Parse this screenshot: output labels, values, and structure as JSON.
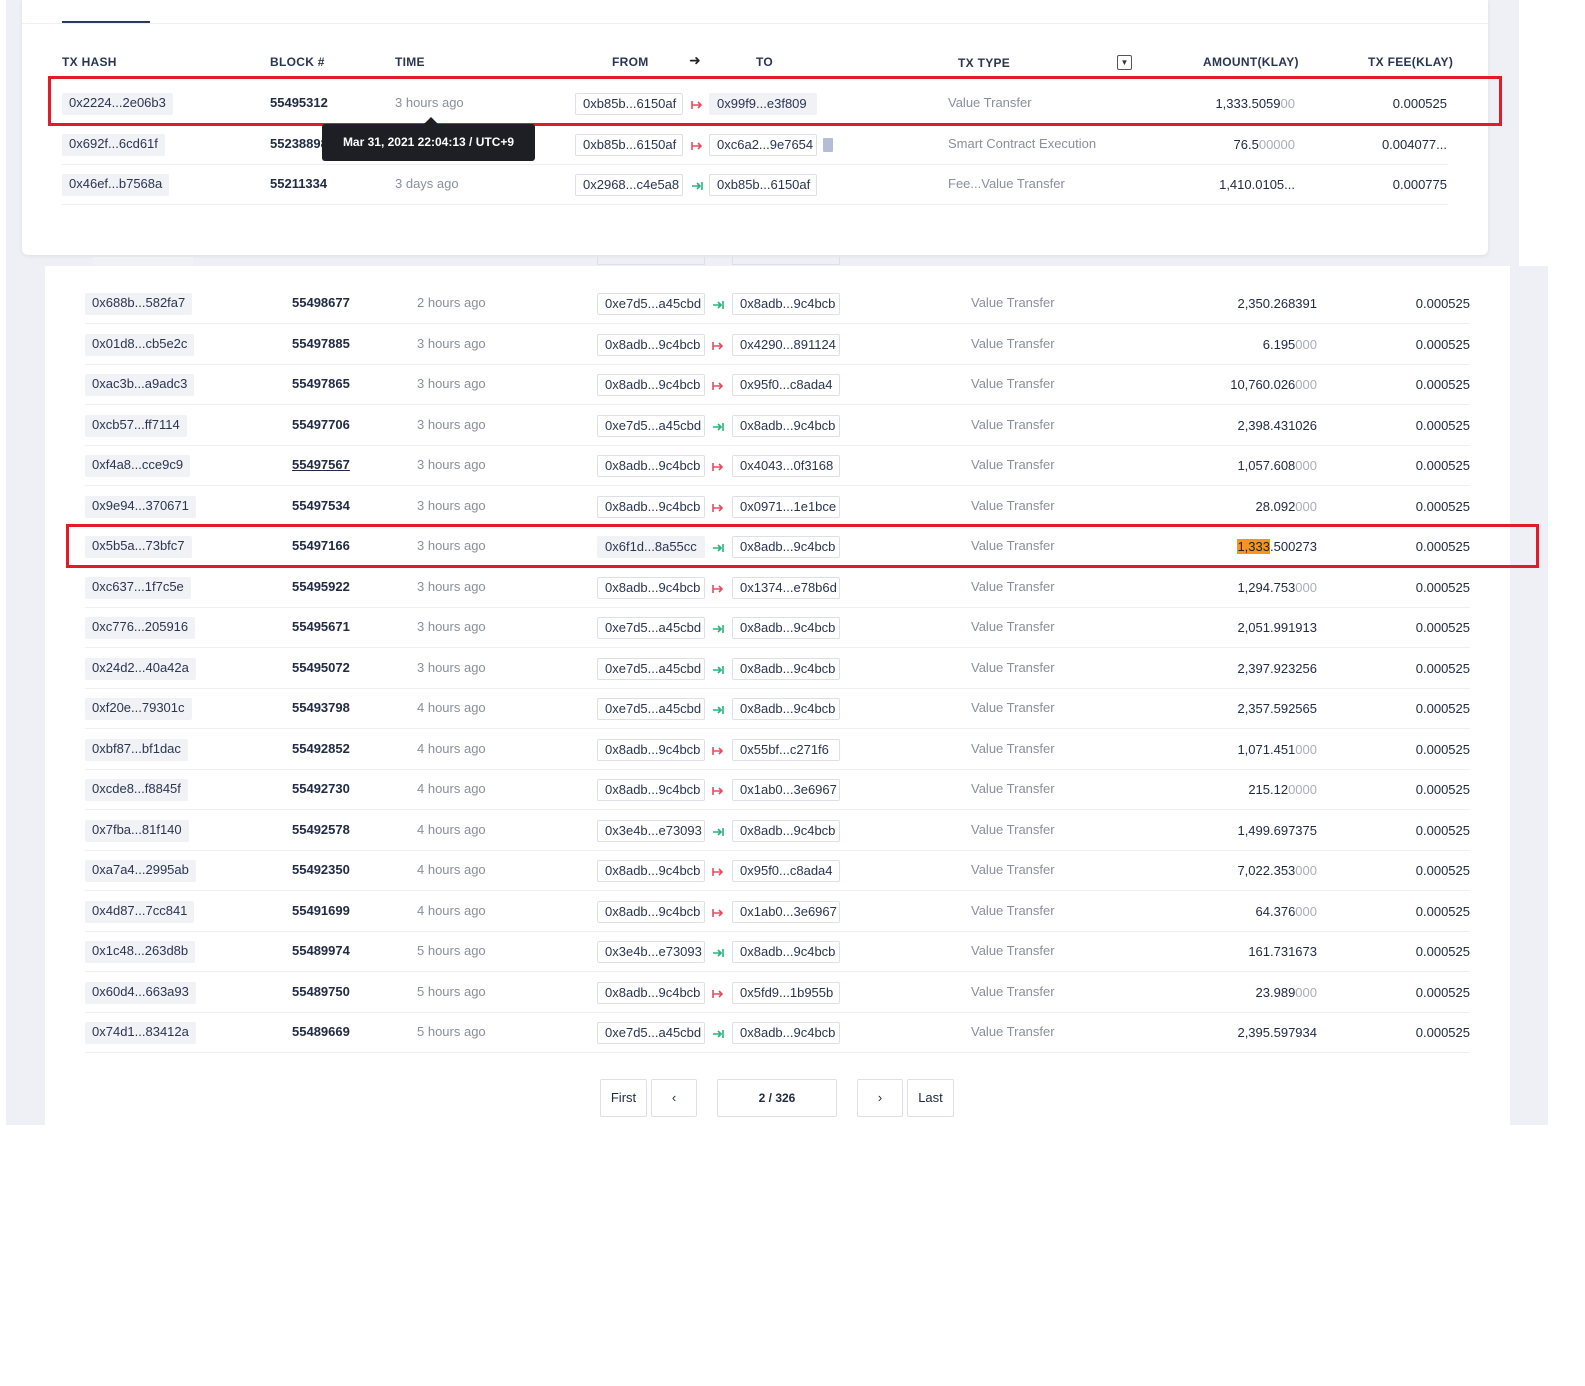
{
  "top": {
    "headers": {
      "tx_hash": "TX HASH",
      "block": "BLOCK #",
      "time": "TIME",
      "from": "FROM",
      "to": "TO",
      "tx_type": "TX TYPE",
      "amount": "AMOUNT(KLAY)",
      "fee": "TX FEE(KLAY)"
    },
    "tooltip": "Mar 31, 2021 22:04:13 / UTC+9",
    "rows": [
      {
        "hash": "0x2224...2e06b3",
        "block": "55495312",
        "time": "3 hours ago",
        "from": "0xb85b...6150af",
        "to": "0x99f9...e3f809",
        "dir": "out",
        "type": "Value Transfer",
        "amt_main": "1,333.5059",
        "amt_dim": "00",
        "fee": "0.000525"
      },
      {
        "hash": "0x692f...6cd61f",
        "block": "55238898",
        "time": "",
        "from": "0xb85b...6150af",
        "to": "0xc6a2...9e7654",
        "dir": "out",
        "type": "Smart Contract Execution",
        "amt_main": "76.5",
        "amt_dim": "00000",
        "fee": "0.004077..."
      },
      {
        "hash": "0x46ef...b7568a",
        "block": "55211334",
        "time": "3 days ago",
        "from": "0x2968...c4e5a8",
        "to": "0xb85b...6150af",
        "dir": "in",
        "type": "Fee...Value Transfer",
        "amt_main": "1,410.0105...",
        "amt_dim": "",
        "fee": "0.000775"
      }
    ]
  },
  "bottom": {
    "rows": [
      {
        "hash": "0x688b...582fa7",
        "block": "55498677",
        "time": "2 hours ago",
        "from": "0xe7d5...a45cbd",
        "to": "0x8adb...9c4bcb",
        "dir": "in",
        "type": "Value Transfer",
        "amt_main": "2,350.268391",
        "amt_dim": "",
        "fee": "0.000525"
      },
      {
        "hash": "0x01d8...cb5e2c",
        "block": "55497885",
        "time": "3 hours ago",
        "from": "0x8adb...9c4bcb",
        "to": "0x4290...891124",
        "dir": "out",
        "type": "Value Transfer",
        "amt_main": "6.195",
        "amt_dim": "000",
        "fee": "0.000525"
      },
      {
        "hash": "0xac3b...a9adc3",
        "block": "55497865",
        "time": "3 hours ago",
        "from": "0x8adb...9c4bcb",
        "to": "0x95f0...c8ada4",
        "dir": "out",
        "type": "Value Transfer",
        "amt_main": "10,760.026",
        "amt_dim": "000",
        "fee": "0.000525"
      },
      {
        "hash": "0xcb57...ff7114",
        "block": "55497706",
        "time": "3 hours ago",
        "from": "0xe7d5...a45cbd",
        "to": "0x8adb...9c4bcb",
        "dir": "in",
        "type": "Value Transfer",
        "amt_main": "2,398.431026",
        "amt_dim": "",
        "fee": "0.000525"
      },
      {
        "hash": "0xf4a8...cce9c9",
        "block": "55497567",
        "time": "3 hours ago",
        "from": "0x8adb...9c4bcb",
        "to": "0x4043...0f3168",
        "dir": "out",
        "type": "Value Transfer",
        "amt_main": "1,057.608",
        "amt_dim": "000",
        "fee": "0.000525"
      },
      {
        "hash": "0x9e94...370671",
        "block": "55497534",
        "time": "3 hours ago",
        "from": "0x8adb...9c4bcb",
        "to": "0x0971...1e1bce",
        "dir": "out",
        "type": "Value Transfer",
        "amt_main": "28.092",
        "amt_dim": "000",
        "fee": "0.000525"
      },
      {
        "hash": "0x5b5a...73bfc7",
        "block": "55497166",
        "time": "3 hours ago",
        "from": "0x6f1d...8a55cc",
        "to": "0x8adb...9c4bcb",
        "dir": "in",
        "type": "Value Transfer",
        "amt_main": ".500273",
        "amt_hl": "1,333",
        "amt_dim": "",
        "fee": "0.000525"
      },
      {
        "hash": "0xc637...1f7c5e",
        "block": "55495922",
        "time": "3 hours ago",
        "from": "0x8adb...9c4bcb",
        "to": "0x1374...e78b6d",
        "dir": "out",
        "type": "Value Transfer",
        "amt_main": "1,294.753",
        "amt_dim": "000",
        "fee": "0.000525"
      },
      {
        "hash": "0xc776...205916",
        "block": "55495671",
        "time": "3 hours ago",
        "from": "0xe7d5...a45cbd",
        "to": "0x8adb...9c4bcb",
        "dir": "in",
        "type": "Value Transfer",
        "amt_main": "2,051.991913",
        "amt_dim": "",
        "fee": "0.000525"
      },
      {
        "hash": "0x24d2...40a42a",
        "block": "55495072",
        "time": "3 hours ago",
        "from": "0xe7d5...a45cbd",
        "to": "0x8adb...9c4bcb",
        "dir": "in",
        "type": "Value Transfer",
        "amt_main": "2,397.923256",
        "amt_dim": "",
        "fee": "0.000525"
      },
      {
        "hash": "0xf20e...79301c",
        "block": "55493798",
        "time": "4 hours ago",
        "from": "0xe7d5...a45cbd",
        "to": "0x8adb...9c4bcb",
        "dir": "in",
        "type": "Value Transfer",
        "amt_main": "2,357.592565",
        "amt_dim": "",
        "fee": "0.000525"
      },
      {
        "hash": "0xbf87...bf1dac",
        "block": "55492852",
        "time": "4 hours ago",
        "from": "0x8adb...9c4bcb",
        "to": "0x55bf...c271f6",
        "dir": "out",
        "type": "Value Transfer",
        "amt_main": "1,071.451",
        "amt_dim": "000",
        "fee": "0.000525"
      },
      {
        "hash": "0xcde8...f8845f",
        "block": "55492730",
        "time": "4 hours ago",
        "from": "0x8adb...9c4bcb",
        "to": "0x1ab0...3e6967",
        "dir": "out",
        "type": "Value Transfer",
        "amt_main": "215.12",
        "amt_dim": "0000",
        "fee": "0.000525"
      },
      {
        "hash": "0x7fba...81f140",
        "block": "55492578",
        "time": "4 hours ago",
        "from": "0x3e4b...e73093",
        "to": "0x8adb...9c4bcb",
        "dir": "in",
        "type": "Value Transfer",
        "amt_main": "1,499.697375",
        "amt_dim": "",
        "fee": "0.000525"
      },
      {
        "hash": "0xa7a4...2995ab",
        "block": "55492350",
        "time": "4 hours ago",
        "from": "0x8adb...9c4bcb",
        "to": "0x95f0...c8ada4",
        "dir": "out",
        "type": "Value Transfer",
        "amt_main": "7,022.353",
        "amt_dim": "000",
        "fee": "0.000525"
      },
      {
        "hash": "0x4d87...7cc841",
        "block": "55491699",
        "time": "4 hours ago",
        "from": "0x8adb...9c4bcb",
        "to": "0x1ab0...3e6967",
        "dir": "out",
        "type": "Value Transfer",
        "amt_main": "64.376",
        "amt_dim": "000",
        "fee": "0.000525"
      },
      {
        "hash": "0x1c48...263d8b",
        "block": "55489974",
        "time": "5 hours ago",
        "from": "0x3e4b...e73093",
        "to": "0x8adb...9c4bcb",
        "dir": "in",
        "type": "Value Transfer",
        "amt_main": "161.731673",
        "amt_dim": "",
        "fee": "0.000525"
      },
      {
        "hash": "0x60d4...663a93",
        "block": "55489750",
        "time": "5 hours ago",
        "from": "0x8adb...9c4bcb",
        "to": "0x5fd9...1b955b",
        "dir": "out",
        "type": "Value Transfer",
        "amt_main": "23.989",
        "amt_dim": "000",
        "fee": "0.000525"
      },
      {
        "hash": "0x74d1...83412a",
        "block": "55489669",
        "time": "5 hours ago",
        "from": "0xe7d5...a45cbd",
        "to": "0x8adb...9c4bcb",
        "dir": "in",
        "type": "Value Transfer",
        "amt_main": "2,395.597934",
        "amt_dim": "",
        "fee": "0.000525"
      }
    ],
    "pagination": {
      "first": "First",
      "prev_icon": "chevron-left-icon",
      "page": "2 / 326",
      "next_icon": "chevron-right-icon",
      "last": "Last"
    }
  },
  "colors": {
    "highlight_box": "#e21b2a",
    "out_arrow": "#e84a5f",
    "in_arrow": "#29b57a",
    "search_highlight": "#f7941d"
  }
}
